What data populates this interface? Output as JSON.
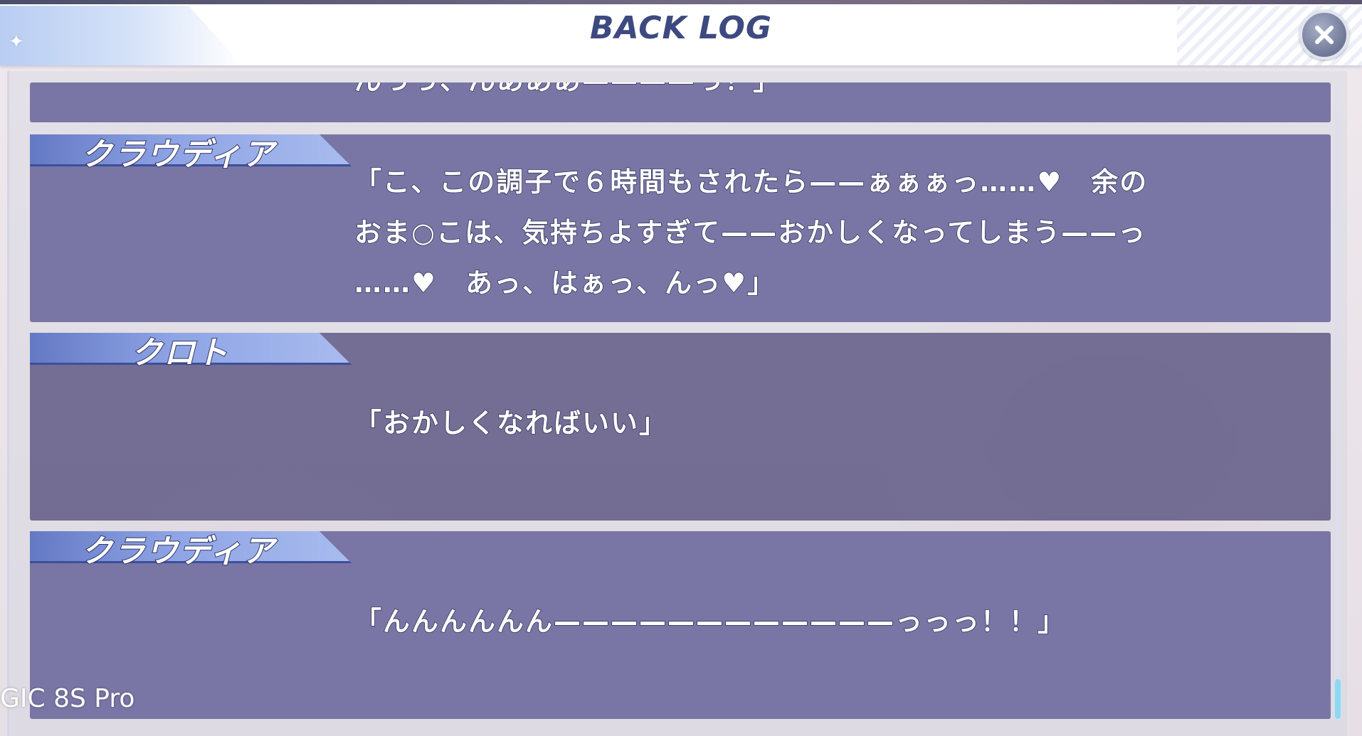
{
  "header": {
    "title": "BACK LOG",
    "close_icon": "close-icon",
    "sparkle_icon": "sparkle-icon"
  },
  "log": {
    "partial_entry": {
      "text": "んっっ、んあああ————っ！」"
    },
    "entries": [
      {
        "speaker": "クラウディア",
        "text": "「こ、この調子で６時間もされたら——ぁぁぁっ……♥　余の\nおま○こは、気持ちよすぎて——おかしくなってしまう——っ\n……♥　あっ、はぁっ、んっ♥」"
      },
      {
        "speaker": "クロト",
        "text": "「おかしくなればいい」"
      },
      {
        "speaker": "クラウディア",
        "text": "「んんんんんん————————————っっっ！！」"
      }
    ]
  },
  "watermark": "GIC 8S Pro",
  "colors": {
    "title": "#3d4a80",
    "entry_bg": "#706ca0",
    "name_tab": "#8ea4e4",
    "scroll_thumb": "#8fd8f2"
  }
}
